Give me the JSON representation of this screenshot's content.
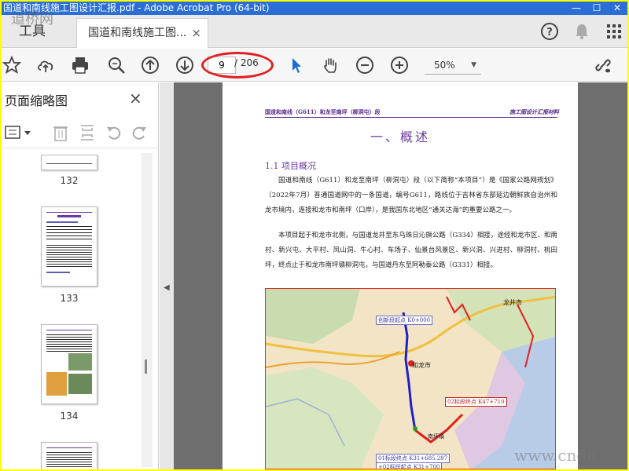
{
  "window": {
    "title": "国道和南线施工图设计汇报.pdf - Adobe Acrobat Pro (64-bit)",
    "minimize": "—",
    "maximize": "☐",
    "close": "✕"
  },
  "tabs": {
    "tools_label": "工具",
    "document_label": "国道和南线施工图...",
    "close_label": "×"
  },
  "toolbar": {
    "current_page": "9",
    "total_pages": "/ 206",
    "zoom": "50%",
    "highlight_color": "#e02020"
  },
  "sidebar": {
    "title": "页面缩略图",
    "close_label": "×",
    "thumbnails": [
      {
        "label": "132"
      },
      {
        "label": "133"
      },
      {
        "label": "134"
      }
    ]
  },
  "document": {
    "header_left": "国道和南线（G611）和龙至南坪（柳洞屯）段",
    "header_right": "施工图设计汇报材料",
    "chapter_title": "一、概述",
    "section_title": "1.1 项目概况",
    "paragraph_1": "国道和南线（G611）和龙至南坪（柳洞屯）段（以下简称“本项目”）是《国家公路网规划》（2022年7月）普通国道网中的一条国道，编号G611，路线位于吉林省东部延边朝鲜族自治州和龙市境内，连接和龙市和南坪（口岸），是我国东北地区“通关达海”的重要公路之一。",
    "paragraph_2": "本项目起于和龙市北侧，与国道龙井至东乌珠日沁旗公路（G334）相接，途经和龙市区、和南村、新兴屯、大平村、凤山洞、牛心村、车场子、仙景台风景区、新兴洞、兴进村、柳洞村、桃田坪，终点止于和龙市南坪镇柳洞屯，与国道丹东至阿勒泰公路（G331）相接。",
    "map": {
      "label_start": "创新段起点 K0+000",
      "label_city": "和龙市",
      "label_city2": "龙井市",
      "label_section2": "02标段终点 K47+710",
      "label_section1": "01标段终点 K31+685.287",
      "label_section1b": "+02标段起点 K31+700",
      "label_city3": "南坪镇"
    }
  },
  "watermarks": {
    "top_left": "道桥网",
    "bottom_right": "www.cnda"
  }
}
